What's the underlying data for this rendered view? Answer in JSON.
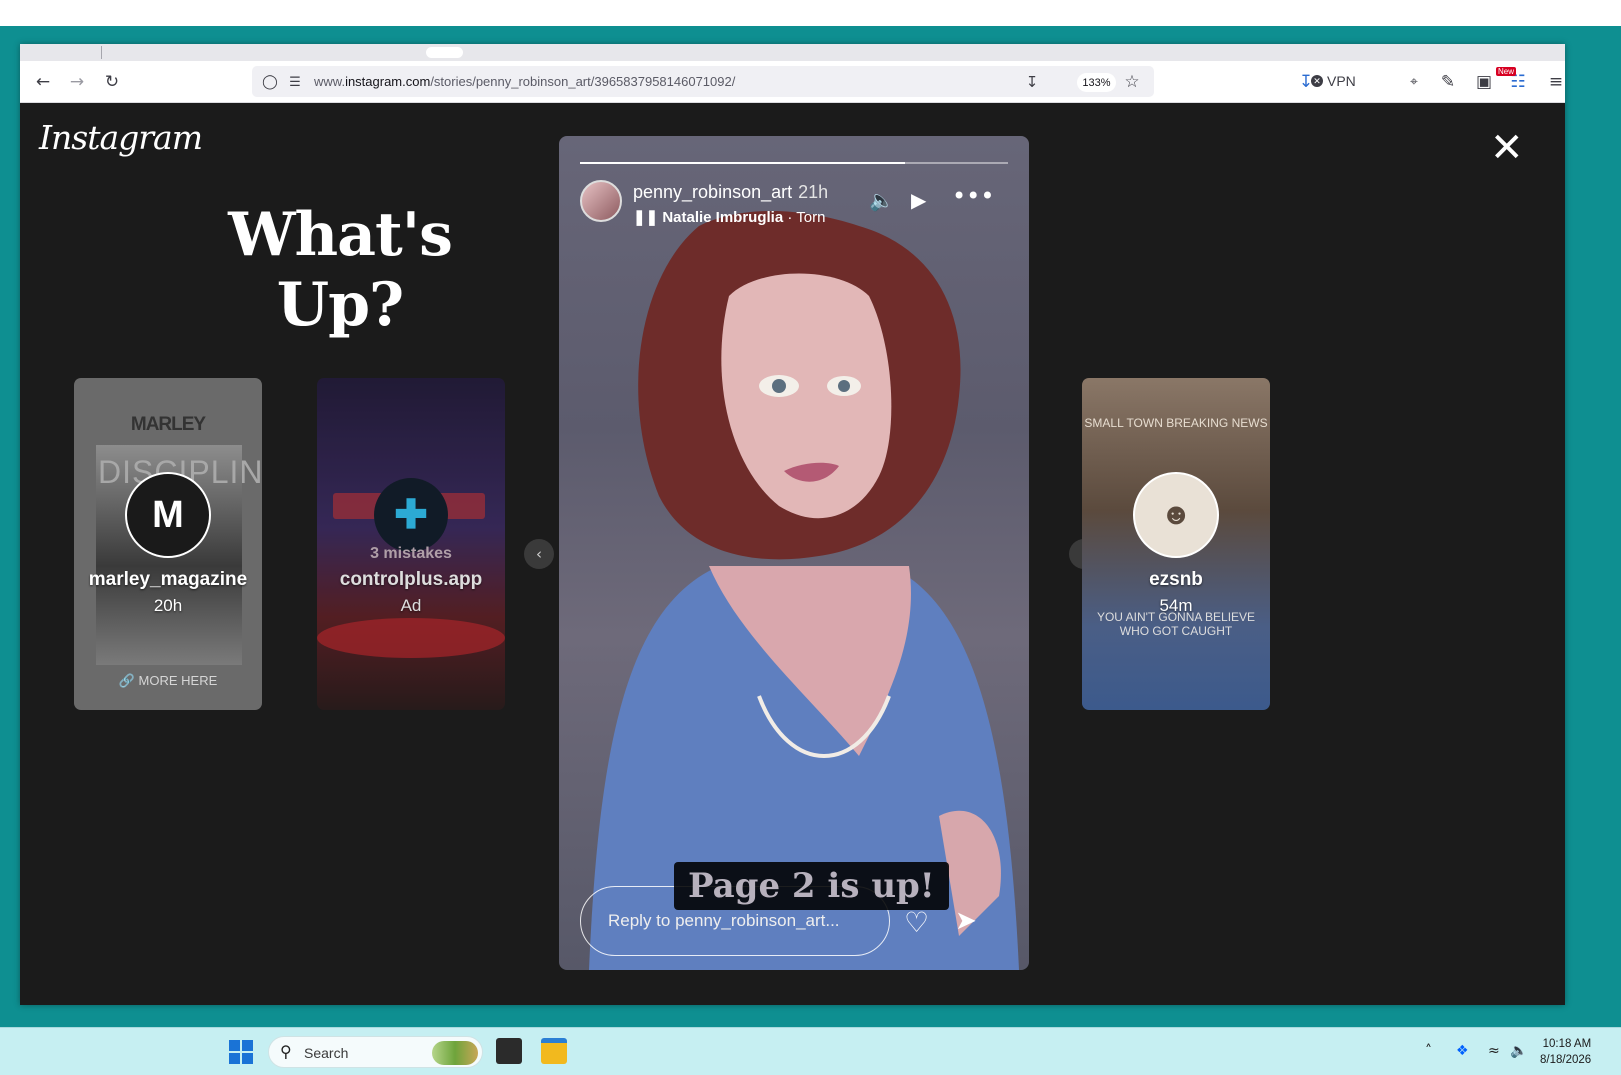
{
  "browser": {
    "url_prefix": "www.",
    "url_domain": "instagram.com",
    "url_path": "/stories/penny_robinson_art/3965837958146071092/",
    "zoom": "133%",
    "vpn_label": "VPN",
    "new_badge": "New",
    "icons": [
      "back-icon",
      "forward-icon",
      "reload-icon",
      "shield-icon",
      "permissions-icon",
      "save-page-icon",
      "bookmark-star-icon",
      "download-icon",
      "extensions-icon",
      "puzzle-icon",
      "sidebar-icon",
      "menu-icon"
    ]
  },
  "instagram": {
    "logo": "Instagram",
    "close_icon": "✕",
    "headline": "What's Up?"
  },
  "side_stories": [
    {
      "username": "marley_magazine",
      "time": "20h",
      "brand": "MARLEY",
      "bigword": "DISCIPLINE",
      "more": "🔗 MORE HERE"
    },
    {
      "username": "controlplus.app",
      "time": "Ad",
      "overlay": "3 mistakes"
    },
    {
      "username": "ezsnb",
      "time": "54m",
      "headline": "SMALL TOWN BREAKING NEWS",
      "sub": "YOU AIN'T GONNA BELIEVE WHO GOT CAUGHT"
    }
  ],
  "story": {
    "username": "penny_robinson_art",
    "time": "21h",
    "artist": "Natalie Imbruglia",
    "song": " · Torn",
    "progress": 0.76,
    "caption": "Page 2 is up!",
    "reply_placeholder": "Reply to penny_robinson_art..."
  },
  "taskbar": {
    "search_label": "Search",
    "time": "10:18 AM",
    "date": "8/18/2026"
  }
}
